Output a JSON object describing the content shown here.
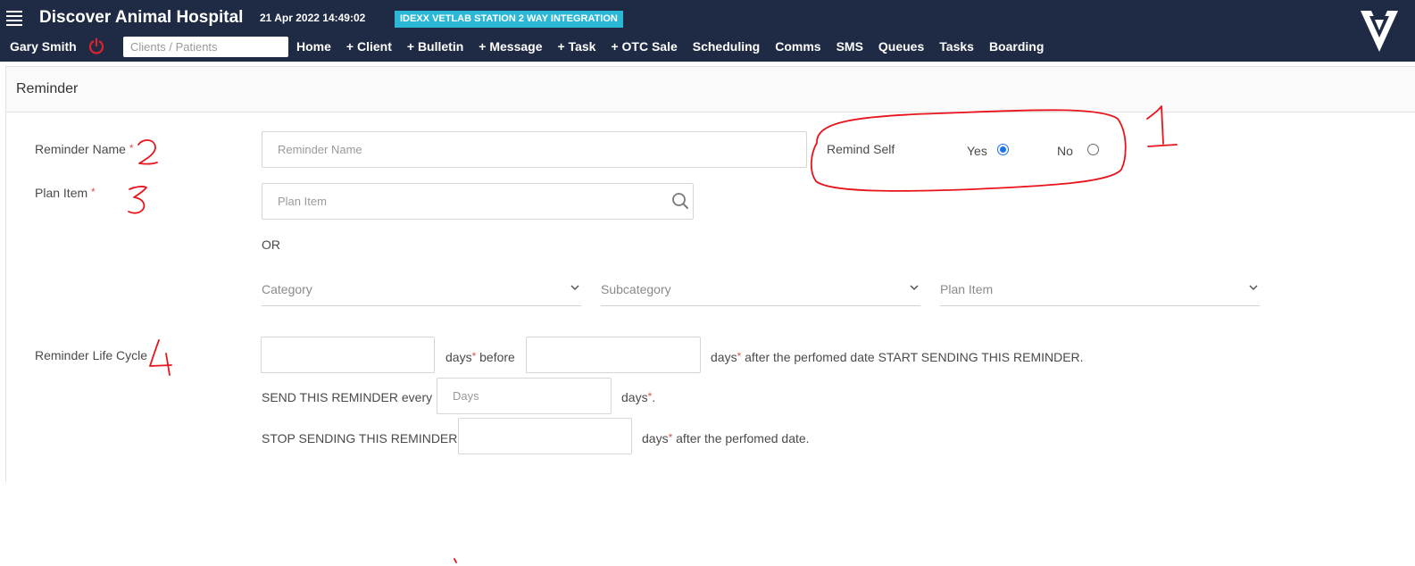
{
  "header": {
    "hospital_name": "Discover Animal Hospital",
    "datetime": "21 Apr 2022 14:49:02",
    "integration_badge": "IDEXX VETLAB STATION 2 WAY INTEGRATION",
    "user_name": "Gary Smith",
    "search_placeholder": "Clients / Patients",
    "nav": [
      "Home",
      "+ Client",
      "+ Bulletin",
      "+ Message",
      "+ Task",
      "+ OTC Sale",
      "Scheduling",
      "Comms",
      "SMS",
      "Queues",
      "Tasks",
      "Boarding"
    ],
    "bg_color": "#1f2a44",
    "badge_color": "#2bb8d6"
  },
  "panel": {
    "title": "Reminder"
  },
  "form": {
    "reminder_name_label": "Reminder Name",
    "required_mark": "*",
    "reminder_name_placeholder": "Reminder Name",
    "remind_self_label": "Remind Self",
    "yes_label": "Yes",
    "no_label": "No",
    "remind_self_value": "Yes",
    "plan_item_label": "Plan Item",
    "plan_item_placeholder": "Plan Item",
    "or_label": "OR",
    "category_placeholder": "Category",
    "subcategory_placeholder": "Subcategory",
    "plan_item_select_placeholder": "Plan Item",
    "life_cycle_label": "Reminder Life Cycle",
    "days_before_text_a": "days",
    "days_before_text_b": " before",
    "days_after_text_a": "days",
    "days_after_text_b": " after the perfomed date START SENDING THIS REMINDER.",
    "send_every_label": "SEND THIS REMINDER every",
    "send_every_placeholder": "Days",
    "send_every_suffix_a": "days",
    "send_every_suffix_b": ".",
    "stop_sending_label": "STOP SENDING THIS REMINDER",
    "stop_suffix_a": "days",
    "stop_suffix_b": " after the perfomed date.",
    "accent_color": "#1a73e8",
    "required_color": "#d9534f"
  },
  "annotation_color": "#e8131b"
}
